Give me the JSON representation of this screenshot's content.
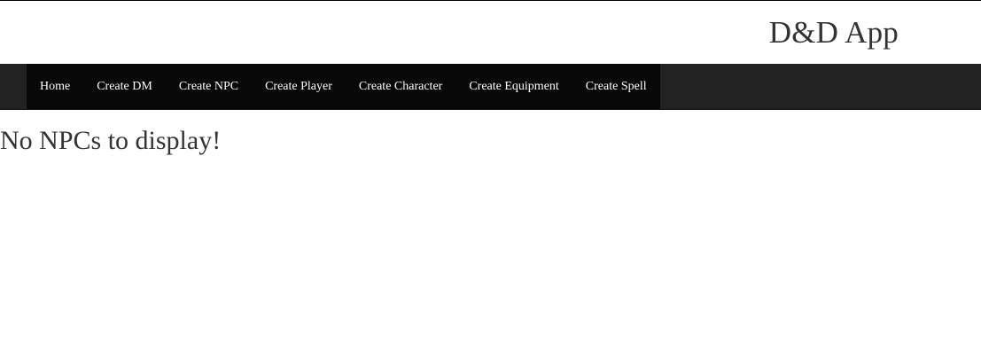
{
  "header": {
    "app_title": "D&D App"
  },
  "navbar": {
    "items": [
      {
        "label": "Home"
      },
      {
        "label": "Create DM"
      },
      {
        "label": "Create NPC"
      },
      {
        "label": "Create Player"
      },
      {
        "label": "Create Character"
      },
      {
        "label": "Create Equipment"
      },
      {
        "label": "Create Spell"
      }
    ]
  },
  "main": {
    "empty_message": "No NPCs to display!"
  },
  "colors": {
    "navbar_background": "#222222",
    "nav_active_background": "#080808",
    "text": "#333333",
    "nav_text": "#ffffff"
  }
}
